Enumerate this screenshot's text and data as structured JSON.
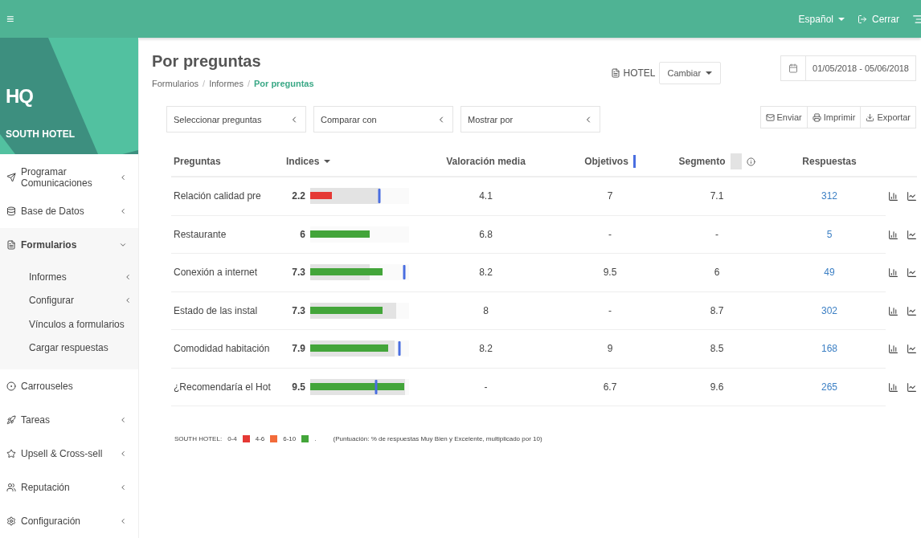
{
  "topbar": {
    "menu_glyph": "≡",
    "language": "Español",
    "logout": "Cerrar"
  },
  "brand": {
    "logo": "HQ",
    "name": "SOUTH HOTEL"
  },
  "sidebar": {
    "items": [
      {
        "label": "Programar Comunicaciones",
        "expandable": true,
        "expanded": false,
        "selected": false
      },
      {
        "label": "Base de Datos",
        "expandable": true,
        "expanded": false,
        "selected": false
      },
      {
        "label": "Formularios",
        "expandable": true,
        "expanded": true,
        "selected": true,
        "children": [
          {
            "label": "Informes",
            "expandable": true
          },
          {
            "label": "Configurar",
            "expandable": true
          },
          {
            "label": "Vínculos a formularios",
            "expandable": false
          },
          {
            "label": "Cargar respuestas",
            "expandable": false
          }
        ]
      },
      {
        "label": "Carrouseles",
        "expandable": false,
        "selected": false
      },
      {
        "label": "Tareas",
        "expandable": true,
        "expanded": false,
        "selected": false
      },
      {
        "label": "Upsell & Cross-sell",
        "expandable": true,
        "expanded": false,
        "selected": false
      },
      {
        "label": "Reputación",
        "expandable": true,
        "expanded": false,
        "selected": false
      },
      {
        "label": "Configuración",
        "expandable": true,
        "expanded": false,
        "selected": false
      }
    ]
  },
  "page": {
    "title": "Por preguntas",
    "breadcrumb_separators": [
      "/",
      "/"
    ],
    "breadcrumb": [
      {
        "label": "Formularios",
        "current": false
      },
      {
        "label": "Informes",
        "current": false
      },
      {
        "label": "Por preguntas",
        "current": true
      }
    ],
    "hotel": "HOTEL",
    "change_button": "Cambiar",
    "date_range": "01/05/2018 - 05/06/2018"
  },
  "filters": [
    "Seleccionar preguntas",
    "Comparar con",
    "Mostrar por"
  ],
  "actions": [
    "Enviar",
    "Imprimir",
    "Exportar"
  ],
  "table": {
    "columns": [
      "Preguntas",
      "Indices",
      "Valoración media",
      "Objetivos",
      "Segmento",
      "Respuestas"
    ],
    "rows": [
      {
        "question": "Relación calidad pre",
        "index": "2.2",
        "bar": {
          "level": 0.22,
          "color": "#e53935"
        },
        "segment": {
          "level": 0.71
        },
        "target": {
          "level": 0.7
        },
        "average": "4.1",
        "objective": "7",
        "segment_value": "7.1",
        "responses": "312"
      },
      {
        "question": "Restaurante",
        "index": "6",
        "bar": {
          "level": 0.6,
          "color": "#43a53a"
        },
        "average": "6.8",
        "objective": "-",
        "segment_value": "-",
        "responses": "5"
      },
      {
        "question": "Conexión a internet",
        "index": "7.3",
        "bar": {
          "level": 0.73,
          "color": "#43a53a"
        },
        "segment": {
          "level": 0.6
        },
        "target": {
          "level": 0.95
        },
        "average": "8.2",
        "objective": "9.5",
        "segment_value": "6",
        "responses": "49"
      },
      {
        "question": "Estado de las instal",
        "index": "7.3",
        "bar": {
          "level": 0.73,
          "color": "#43a53a"
        },
        "segment": {
          "level": 0.87
        },
        "average": "8",
        "objective": "-",
        "segment_value": "8.7",
        "responses": "302"
      },
      {
        "question": "Comodidad habitación",
        "index": "7.9",
        "bar": {
          "level": 0.79,
          "color": "#43a53a"
        },
        "segment": {
          "level": 0.85
        },
        "target": {
          "level": 0.9
        },
        "average": "8.2",
        "objective": "9",
        "segment_value": "8.5",
        "responses": "168"
      },
      {
        "question": "¿Recomendaría el Hot",
        "index": "9.5",
        "bar": {
          "level": 0.95,
          "color": "#43a53a"
        },
        "segment": {
          "level": 0.96
        },
        "target": {
          "level": 0.67
        },
        "average": "-",
        "objective": "6.7",
        "segment_value": "9.6",
        "responses": "265"
      }
    ]
  },
  "legend": {
    "label": "SOUTH HOTEL:",
    "items": [
      {
        "label": "0-4",
        "color": "#e53935"
      },
      {
        "label": "4-6",
        "color": "#f26b3a"
      },
      {
        "label": "6-10",
        "color": "#43a53a"
      }
    ],
    "end": ".",
    "note": "(Puntuación: % de respuestas Muy Bien y Excelente, multiplicado por 10)"
  }
}
